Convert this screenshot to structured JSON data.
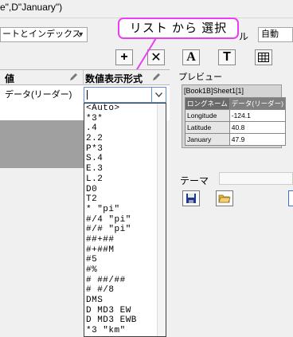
{
  "formula_bar": {
    "text": "e\",D\"January\")"
  },
  "sheet_selector": {
    "value": "ートとインデックス"
  },
  "right_top": {
    "label": "ル",
    "value": "自動"
  },
  "toolbar": {
    "add_glyph": "+",
    "delete_glyph": "✕",
    "font_a_glyph": "A",
    "text_t_glyph": "T"
  },
  "callout": {
    "text": "リスト から 選択"
  },
  "grid": {
    "columns": [
      {
        "label": "値"
      },
      {
        "label": "数値表示形式"
      }
    ],
    "row_value": "データ(リーダー)"
  },
  "dropdown": {
    "current_value": "",
    "options": [
      "<Auto>",
      "*3*",
      ".4",
      "2.2",
      "P*3",
      "S.4",
      "E.3",
      "L.2",
      "D0",
      "T2",
      "* \"pi\"",
      "#/4 \"pi\"",
      "#/# \"pi\"",
      "##+##",
      "#+##M",
      "#5",
      "#%",
      "# ##/##",
      "# #/8",
      "DMS",
      "D MD3 EW",
      "D MD3 EWB",
      "*3 \"km\"",
      "\"$\"*"
    ]
  },
  "preview": {
    "label": "プレビュー",
    "title": "[Book1B]Sheet1[1]",
    "header": [
      "ロングネーム",
      "データ(リーダー)"
    ],
    "rows": [
      [
        "Longitude",
        "-124.1"
      ],
      [
        "Latitude",
        "40.8"
      ],
      [
        "January",
        "47.9"
      ]
    ]
  },
  "theme": {
    "label": "テーマ"
  },
  "colors": {
    "callout_border": "#e83ff0",
    "callout_line": "#e83ff0",
    "dropdown_focus": "#5b8fd6"
  }
}
